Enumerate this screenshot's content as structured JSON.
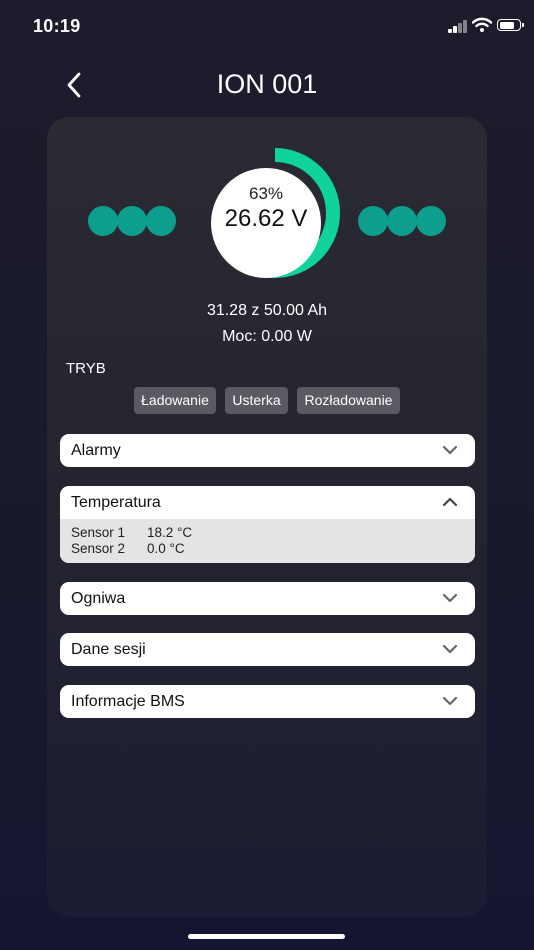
{
  "status": {
    "time": "10:19",
    "battery_level": 0.8
  },
  "header": {
    "title": "ION 001"
  },
  "gauge": {
    "percent_label": "63%",
    "fill_fraction": 0.63,
    "voltage": "26.62 V",
    "color": "#10d39a"
  },
  "capacity": "31.28 z 50.00 Ah",
  "power": "Moc: 0.00 W",
  "mode": {
    "label": "TRYB",
    "buttons": [
      "Ładowanie",
      "Usterka",
      "Rozładowanie"
    ]
  },
  "sections": {
    "alarms": "Alarmy",
    "temperature": {
      "title": "Temperatura",
      "sensors": [
        {
          "name": "Sensor 1",
          "value": "18.2 °C"
        },
        {
          "name": "Sensor 2",
          "value": "0.0 °C"
        }
      ]
    },
    "cells": "Ogniwa",
    "session": "Dane sesji",
    "bms": "Informacje BMS"
  },
  "icons": {
    "back": "chevron-left-icon",
    "expand": "chevron-down-icon",
    "collapse": "chevron-up-icon",
    "signal": "cellular-signal-icon",
    "wifi": "wifi-icon",
    "battery": "battery-icon"
  },
  "colors": {
    "accent": "#10d39a",
    "dots": "#0e9e8e"
  }
}
